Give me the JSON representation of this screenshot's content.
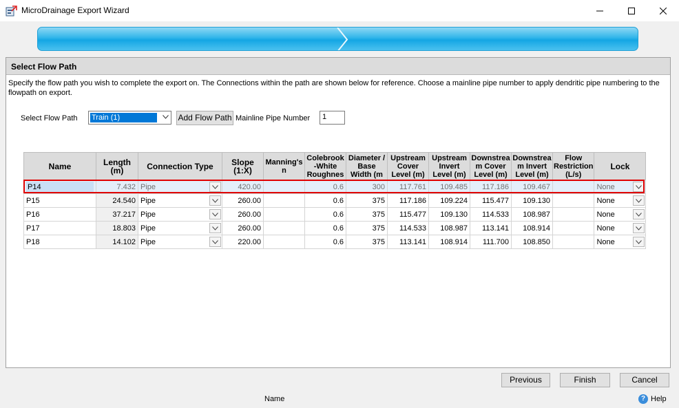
{
  "window": {
    "title": "MicroDrainage Export Wizard"
  },
  "panel": {
    "header": "Select Flow Path",
    "description": "Specify the flow path you wish to complete the export on. The Connections within the path are shown below for reference. Choose a mainline pipe number to apply dendritic pipe numbering to the flowpath on export.",
    "select_flow_path_label": "Select Flow Path",
    "select_flow_path_value": "Train (1)",
    "add_flow_path_label": "Add Flow Path",
    "mainline_label": "Mainline Pipe Number",
    "mainline_value": "1"
  },
  "table": {
    "headers": {
      "name": "Name",
      "length": "Length (m)",
      "connection_type": "Connection Type",
      "slope": "Slope (1:X)",
      "mannings": "Manning's n",
      "colebrook": "Colebrook -White Roughnes",
      "diameter": "Diameter / Base Width (m",
      "upstream_cover": "Upstream Cover Level (m)",
      "upstream_invert": "Upstream Invert Level (m)",
      "downstream_cover": "Downstrea m Cover Level (m)",
      "downstream_invert": "Downstrea m Invert Level (m)",
      "flow_restriction": "Flow Restriction (L/s)",
      "lock": "Lock"
    },
    "rows": [
      {
        "name": "P14",
        "length": "7.432",
        "type": "Pipe",
        "slope": "420.00",
        "mannings": "",
        "colebrook": "0.6",
        "diameter": "300",
        "us_cover": "117.761",
        "us_invert": "109.485",
        "ds_cover": "117.186",
        "ds_invert": "109.467",
        "flow": "",
        "lock": "None"
      },
      {
        "name": "P15",
        "length": "24.540",
        "type": "Pipe",
        "slope": "260.00",
        "mannings": "",
        "colebrook": "0.6",
        "diameter": "375",
        "us_cover": "117.186",
        "us_invert": "109.224",
        "ds_cover": "115.477",
        "ds_invert": "109.130",
        "flow": "",
        "lock": "None"
      },
      {
        "name": "P16",
        "length": "37.217",
        "type": "Pipe",
        "slope": "260.00",
        "mannings": "",
        "colebrook": "0.6",
        "diameter": "375",
        "us_cover": "115.477",
        "us_invert": "109.130",
        "ds_cover": "114.533",
        "ds_invert": "108.987",
        "flow": "",
        "lock": "None"
      },
      {
        "name": "P17",
        "length": "18.803",
        "type": "Pipe",
        "slope": "260.00",
        "mannings": "",
        "colebrook": "0.6",
        "diameter": "375",
        "us_cover": "114.533",
        "us_invert": "108.987",
        "ds_cover": "113.141",
        "ds_invert": "108.914",
        "flow": "",
        "lock": "None"
      },
      {
        "name": "P18",
        "length": "14.102",
        "type": "Pipe",
        "slope": "220.00",
        "mannings": "",
        "colebrook": "0.6",
        "diameter": "375",
        "us_cover": "113.141",
        "us_invert": "108.914",
        "ds_cover": "111.700",
        "ds_invert": "108.850",
        "flow": "",
        "lock": "None"
      }
    ]
  },
  "footer": {
    "previous": "Previous",
    "finish": "Finish",
    "cancel": "Cancel",
    "status_name": "Name",
    "help": "Help"
  },
  "colors": {
    "progress": "#14a6e4",
    "selection_outline": "#e00000",
    "selected_text": "#0078d7"
  },
  "icons": [
    "app-icon",
    "minimize-icon",
    "maximize-icon",
    "close-icon",
    "chevron-down-icon",
    "help-icon"
  ]
}
